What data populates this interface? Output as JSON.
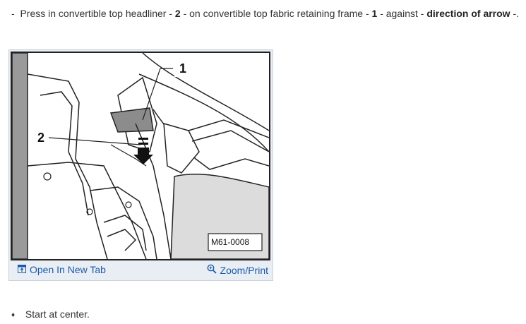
{
  "instruction": {
    "dash": "-",
    "part1": "Press in convertible top headliner -",
    "num2": "2",
    "part2": "- on convertible top fabric retaining frame -",
    "num1": "1",
    "part3": "- against -",
    "emph": "direction of arrow",
    "part4": "-."
  },
  "figure": {
    "callout_1": "1",
    "callout_2": "2",
    "image_code": "M61-0008",
    "open_tab_label": "Open In New Tab",
    "zoom_label": "Zoom/Print",
    "link_color": "#1a5aa8"
  },
  "bullets": [
    {
      "icon": "diamond-icon",
      "text": "Start at center."
    }
  ]
}
